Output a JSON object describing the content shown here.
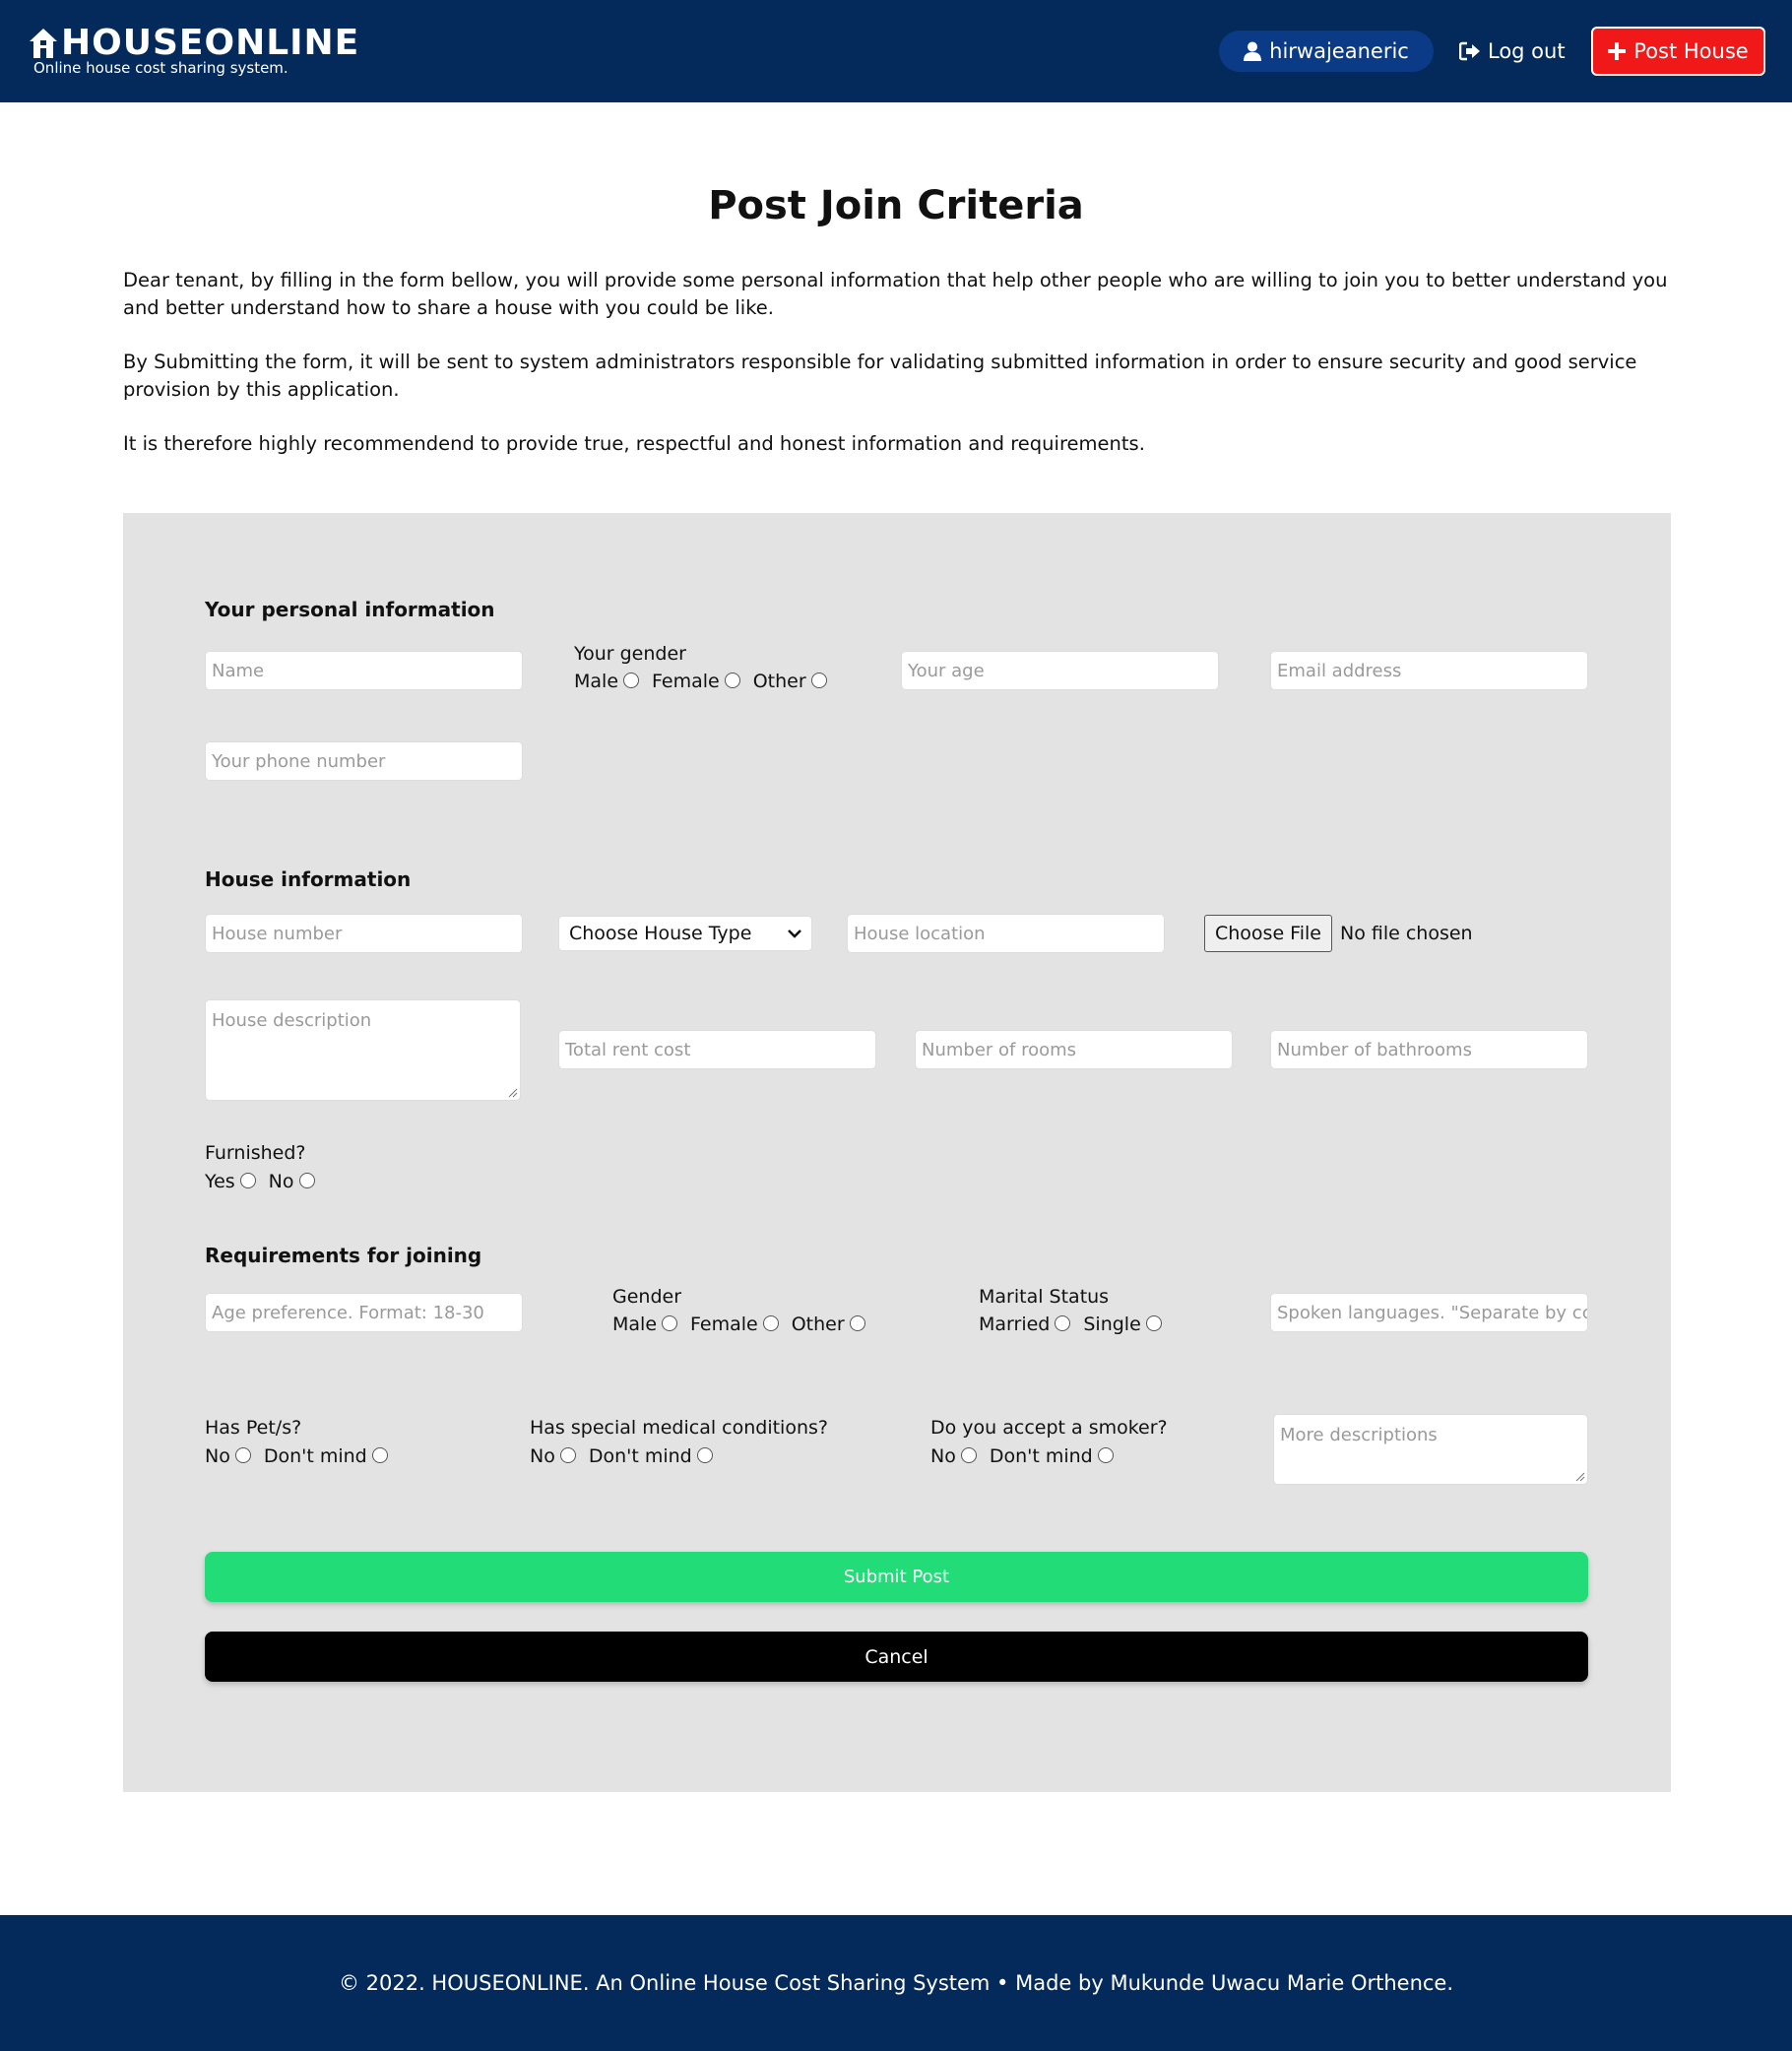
{
  "header": {
    "brand_name": "HOUSEONLINE",
    "brand_tagline": "Online house cost sharing system.",
    "username": "hirwajeaneric",
    "logout_label": "Log out",
    "post_house_label": "Post House"
  },
  "colors": {
    "navy": "#042a5c",
    "user_pill": "#0b3b86",
    "post_button": "#f01818",
    "submit": "#22dd77",
    "panel": "#e3e3e3"
  },
  "page": {
    "title": "Post Join Criteria",
    "intro_1": "Dear tenant, by filling in the form bellow, you will provide some personal information that help other people who are willing to join you to better understand you and better understand how to share a house with you could be like.",
    "intro_2": "By Submitting the form, it will be sent to system administrators responsible for validating submitted information in order to ensure security and good service provision by this application.",
    "intro_3": "It is therefore highly recommendend to provide true, respectful and honest information and requirements."
  },
  "personal": {
    "title": "Your personal information",
    "name_placeholder": "Name",
    "gender_label": "Your gender",
    "gender_male": "Male",
    "gender_female": "Female",
    "gender_other": "Other",
    "age_placeholder": "Your age",
    "email_placeholder": "Email address",
    "phone_placeholder": "Your phone number"
  },
  "house": {
    "title": "House information",
    "number_placeholder": "House number",
    "type_select": "Choose House Type",
    "location_placeholder": "House location",
    "file_button": "Choose File",
    "file_status": "No file chosen",
    "description_placeholder": "House description",
    "rent_placeholder": "Total rent cost",
    "rooms_placeholder": "Number of rooms",
    "bathrooms_placeholder": "Number of bathrooms",
    "furnished_label": "Furnished?",
    "furnished_yes": "Yes",
    "furnished_no": "No"
  },
  "requirements": {
    "title": "Requirements for joining",
    "age_placeholder": "Age preference. Format: 18-30",
    "gender_label": "Gender",
    "gender_male": "Male",
    "gender_female": "Female",
    "gender_other": "Other",
    "marital_label": "Marital Status",
    "marital_married": "Married",
    "marital_single": "Single",
    "languages_placeholder": "Spoken languages. \"Separate by cc",
    "pets_label": "Has Pet/s?",
    "pets_no": "No",
    "pets_dont_mind": "Don't mind",
    "medical_label": "Has special medical conditions?",
    "medical_no": "No",
    "medical_dont_mind": "Don't mind",
    "smoker_label": "Do you accept a smoker?",
    "smoker_no": "No",
    "smoker_dont_mind": "Don't mind",
    "more_placeholder": "More descriptions"
  },
  "actions": {
    "submit_label": "Submit Post",
    "cancel_label": "Cancel"
  },
  "footer": {
    "text": "© 2022. HOUSEONLINE. An Online House Cost Sharing System • Made by Mukunde Uwacu Marie Orthence."
  }
}
